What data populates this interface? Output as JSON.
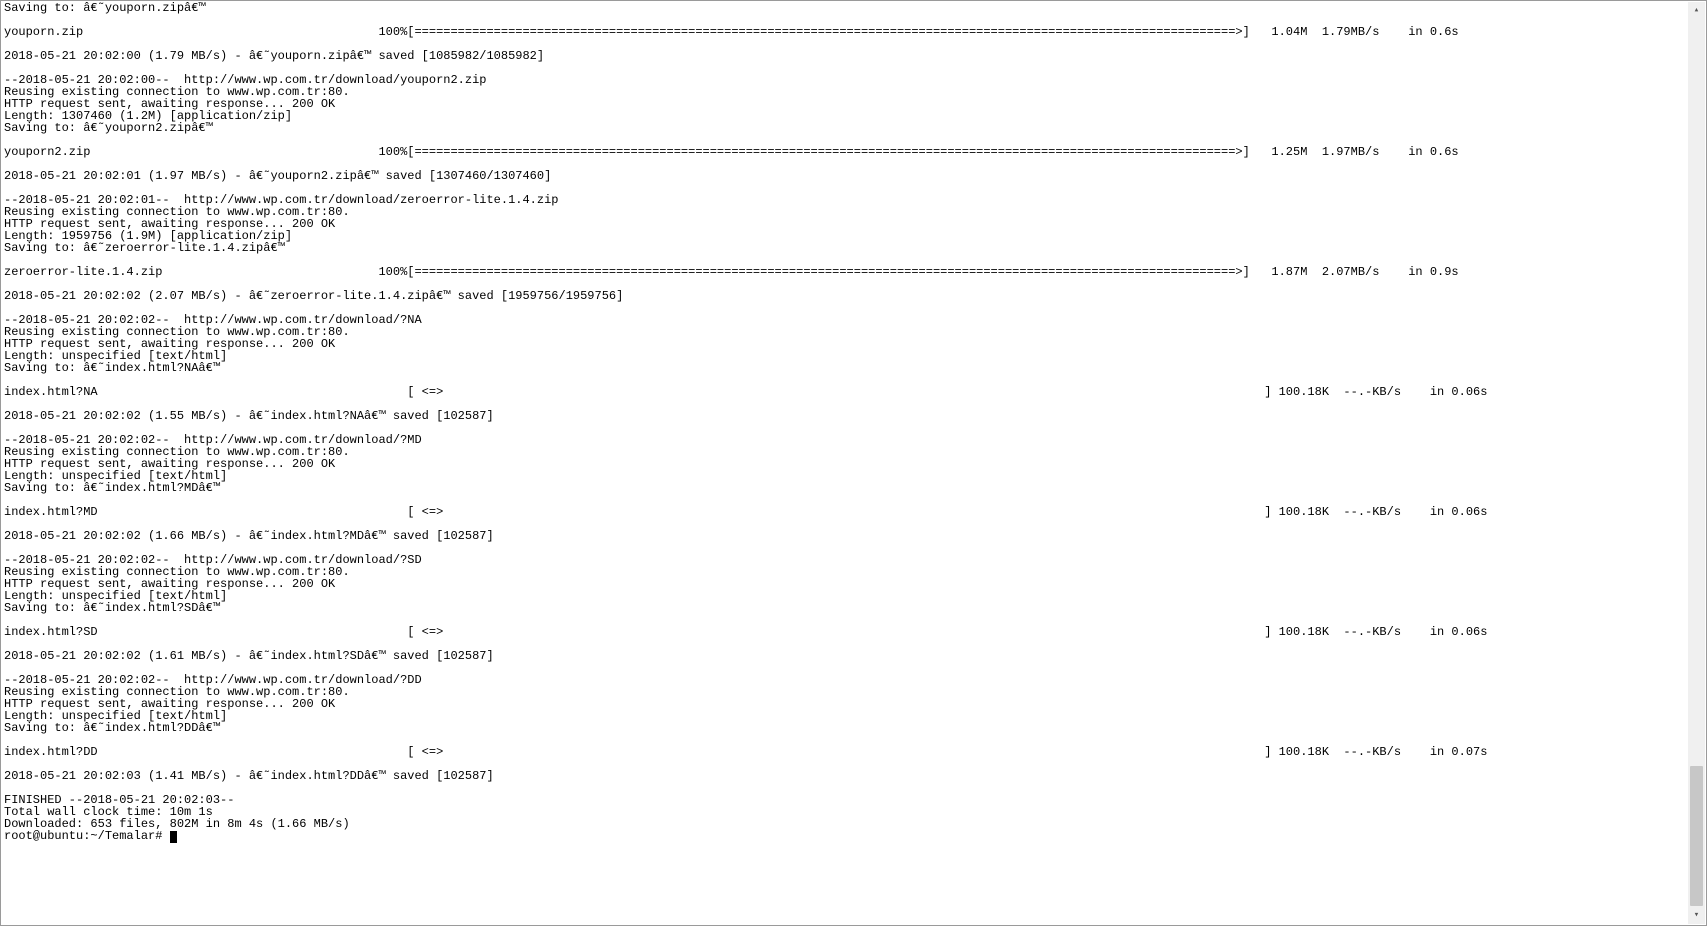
{
  "terminal": {
    "prompt": "root@ubuntu:~/Temalar# ",
    "summary": {
      "finished": "FINISHED --2018-05-21 20:02:03--",
      "wallclock": "Total wall clock time: 10m 1s",
      "downloaded": "Downloaded: 653 files, 802M in 8m 4s (1.66 MB/s)"
    },
    "head_saving": "Saving to: â€˜youporn.zipâ€™",
    "blocks": [
      {
        "file": "youporn.zip",
        "percent": "100%",
        "bar_full": true,
        "size": "1.04M",
        "speed": "1.79MB/s",
        "eta": "in 0.6s",
        "saved": "2018-05-21 20:02:00 (1.79 MB/s) - â€˜youporn.zipâ€™ saved [1085982/1085982]",
        "req": [
          "--2018-05-21 20:02:00--  http://www.wp.com.tr/download/youporn2.zip",
          "Reusing existing connection to www.wp.com.tr:80.",
          "HTTP request sent, awaiting response... 200 OK",
          "Length: 1307460 (1.2M) [application/zip]",
          "Saving to: â€˜youporn2.zipâ€™"
        ]
      },
      {
        "file": "youporn2.zip",
        "percent": "100%",
        "bar_full": true,
        "size": "1.25M",
        "speed": "1.97MB/s",
        "eta": "in 0.6s",
        "saved": "2018-05-21 20:02:01 (1.97 MB/s) - â€˜youporn2.zipâ€™ saved [1307460/1307460]",
        "req": [
          "--2018-05-21 20:02:01--  http://www.wp.com.tr/download/zeroerror-lite.1.4.zip",
          "Reusing existing connection to www.wp.com.tr:80.",
          "HTTP request sent, awaiting response... 200 OK",
          "Length: 1959756 (1.9M) [application/zip]",
          "Saving to: â€˜zeroerror-lite.1.4.zipâ€™"
        ]
      },
      {
        "file": "zeroerror-lite.1.4.zip",
        "percent": "100%",
        "bar_full": true,
        "size": "1.87M",
        "speed": "2.07MB/s",
        "eta": "in 0.9s",
        "saved": "2018-05-21 20:02:02 (2.07 MB/s) - â€˜zeroerror-lite.1.4.zipâ€™ saved [1959756/1959756]",
        "req": [
          "--2018-05-21 20:02:02--  http://www.wp.com.tr/download/?NA",
          "Reusing existing connection to www.wp.com.tr:80.",
          "HTTP request sent, awaiting response... 200 OK",
          "Length: unspecified [text/html]",
          "Saving to: â€˜index.html?NAâ€™"
        ]
      },
      {
        "file": "index.html?NA",
        "percent": "",
        "bar_full": false,
        "size": "100.18K",
        "speed": "--.-KB/s",
        "eta": "in 0.06s",
        "saved": "2018-05-21 20:02:02 (1.55 MB/s) - â€˜index.html?NAâ€™ saved [102587]",
        "req": [
          "--2018-05-21 20:02:02--  http://www.wp.com.tr/download/?MD",
          "Reusing existing connection to www.wp.com.tr:80.",
          "HTTP request sent, awaiting response... 200 OK",
          "Length: unspecified [text/html]",
          "Saving to: â€˜index.html?MDâ€™"
        ]
      },
      {
        "file": "index.html?MD",
        "percent": "",
        "bar_full": false,
        "size": "100.18K",
        "speed": "--.-KB/s",
        "eta": "in 0.06s",
        "saved": "2018-05-21 20:02:02 (1.66 MB/s) - â€˜index.html?MDâ€™ saved [102587]",
        "req": [
          "--2018-05-21 20:02:02--  http://www.wp.com.tr/download/?SD",
          "Reusing existing connection to www.wp.com.tr:80.",
          "HTTP request sent, awaiting response... 200 OK",
          "Length: unspecified [text/html]",
          "Saving to: â€˜index.html?SDâ€™"
        ]
      },
      {
        "file": "index.html?SD",
        "percent": "",
        "bar_full": false,
        "size": "100.18K",
        "speed": "--.-KB/s",
        "eta": "in 0.06s",
        "saved": "2018-05-21 20:02:02 (1.61 MB/s) - â€˜index.html?SDâ€™ saved [102587]",
        "req": [
          "--2018-05-21 20:02:02--  http://www.wp.com.tr/download/?DD",
          "Reusing existing connection to www.wp.com.tr:80.",
          "HTTP request sent, awaiting response... 200 OK",
          "Length: unspecified [text/html]",
          "Saving to: â€˜index.html?DDâ€™"
        ]
      },
      {
        "file": "index.html?DD",
        "percent": "",
        "bar_full": false,
        "size": "100.18K",
        "speed": "--.-KB/s",
        "eta": "in 0.07s",
        "saved": "2018-05-21 20:02:03 (1.41 MB/s) - â€˜index.html?DDâ€™ saved [102587]",
        "req": []
      }
    ]
  },
  "layout": {
    "file_col_width": 56,
    "bar_open_col": 56,
    "bar_width_full": 114,
    "bar_width_unspec": 114,
    "size_col_width": 9,
    "speed_col_width": 10,
    "eta_pad": 4
  }
}
